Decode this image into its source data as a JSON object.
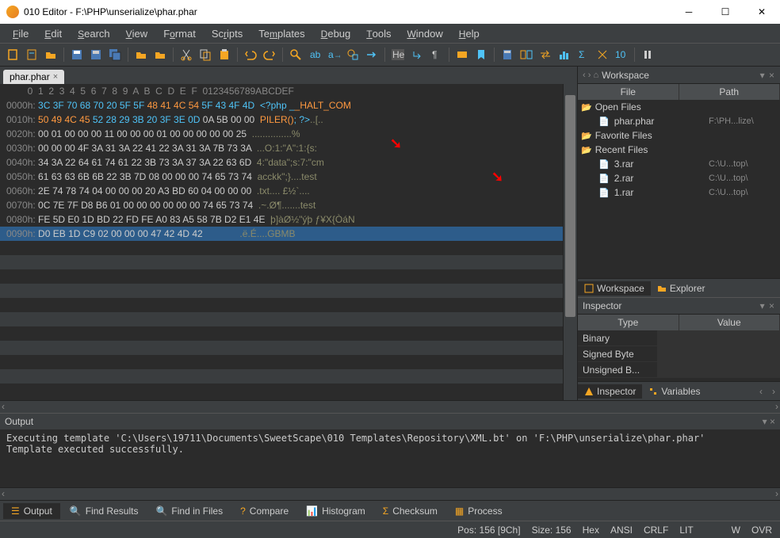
{
  "window": {
    "title": "010 Editor - F:\\PHP\\unserialize\\phar.phar"
  },
  "menu": [
    "File",
    "Edit",
    "Search",
    "View",
    "Format",
    "Scripts",
    "Templates",
    "Debug",
    "Tools",
    "Window",
    "Help"
  ],
  "filetab": {
    "name": "phar.phar"
  },
  "hex": {
    "header_offsets": " 0  1  2  3  4  5  6  7  8  9  A  B  C  D  E  F",
    "header_ascii": "0123456789ABCDEF",
    "rows": [
      {
        "off": "0000h:",
        "b": [
          "3C",
          "3F",
          "70",
          "68",
          "70",
          "20",
          "5F",
          "5F",
          "48",
          "41",
          "4C",
          "54",
          "5F",
          "43",
          "4F",
          "4D"
        ],
        "cls": [
          "hxhl",
          "hxhl",
          "hxhl",
          "hxhl",
          "hxhl",
          "hxhl",
          "hxhl",
          "hxhl",
          "hxor",
          "hxor",
          "hxor",
          "hxor",
          "hxhl",
          "hxhl",
          "hxhl",
          "hxhl"
        ],
        "asc": "<?php __HALT_COM",
        "acls": [
          "ascblue",
          "ascblue",
          "ascblue",
          "ascblue",
          "ascblue",
          "ascblue",
          "ascblue",
          "ascor",
          "ascor",
          "ascor",
          "ascor",
          "ascor",
          "ascor",
          "ascor",
          "ascor",
          "ascor"
        ]
      },
      {
        "off": "0010h:",
        "b": [
          "50",
          "49",
          "4C",
          "45",
          "52",
          "28",
          "29",
          "3B",
          "20",
          "3F",
          "3E",
          "0D",
          "0A",
          "5B",
          "00",
          "00"
        ],
        "cls": [
          "hxor",
          "hxor",
          "hxor",
          "hxor",
          "hxhl",
          "hxhl",
          "hxhl",
          "hxhl",
          "hxhl",
          "hxhl",
          "hxhl",
          "hxhl",
          "hx",
          "hx",
          "hx",
          "hx"
        ],
        "asc": "PILER(); ?>..[..",
        "acls": [
          "ascor",
          "ascor",
          "ascor",
          "ascor",
          "ascor",
          "ascor",
          "ascor",
          "ascblue",
          "ascblue",
          "ascblue",
          "ascblue",
          "ascgr",
          "ascgr",
          "ascgr",
          "ascgr",
          "ascgr"
        ]
      },
      {
        "off": "0020h:",
        "b": [
          "00",
          "01",
          "00",
          "00",
          "00",
          "11",
          "00",
          "00",
          "00",
          "01",
          "00",
          "00",
          "00",
          "00",
          "00",
          "25"
        ],
        "cls": [
          "hx",
          "hx",
          "hx",
          "hx",
          "hx",
          "hx",
          "hx",
          "hx",
          "hx",
          "hx",
          "hx",
          "hx",
          "hx",
          "hx",
          "hx",
          "hx"
        ],
        "asc": "...............%",
        "acls": [
          "ascgr",
          "ascgr",
          "ascgr",
          "ascgr",
          "ascgr",
          "ascgr",
          "ascgr",
          "ascgr",
          "ascgr",
          "ascgr",
          "ascgr",
          "ascgr",
          "ascgr",
          "ascgr",
          "ascgr",
          "ascgr"
        ]
      },
      {
        "off": "0030h:",
        "b": [
          "00",
          "00",
          "00",
          "4F",
          "3A",
          "31",
          "3A",
          "22",
          "41",
          "22",
          "3A",
          "31",
          "3A",
          "7B",
          "73",
          "3A"
        ],
        "cls": [
          "hx",
          "hx",
          "hx",
          "hx",
          "hx",
          "hx",
          "hx",
          "hx",
          "hx",
          "hx",
          "hx",
          "hx",
          "hx",
          "hx",
          "hx",
          "hx"
        ],
        "asc": "...O:1:\"A\":1:{s:",
        "acls": [
          "ascgr",
          "ascgr",
          "ascgr",
          "ascgr",
          "ascgr",
          "ascgr",
          "ascgr",
          "ascgr",
          "ascgr",
          "ascgr",
          "ascgr",
          "ascgr",
          "ascgr",
          "ascgr",
          "ascgr",
          "ascgr"
        ]
      },
      {
        "off": "0040h:",
        "b": [
          "34",
          "3A",
          "22",
          "64",
          "61",
          "74",
          "61",
          "22",
          "3B",
          "73",
          "3A",
          "37",
          "3A",
          "22",
          "63",
          "6D"
        ],
        "cls": [
          "hx",
          "hx",
          "hx",
          "hx",
          "hx",
          "hx",
          "hx",
          "hx",
          "hx",
          "hx",
          "hx",
          "hx",
          "hx",
          "hx",
          "hx",
          "hx"
        ],
        "asc": "4:\"data\";s:7:\"cm",
        "acls": [
          "ascgr",
          "ascgr",
          "ascgr",
          "ascgr",
          "ascgr",
          "ascgr",
          "ascgr",
          "ascgr",
          "ascgr",
          "ascgr",
          "ascgr",
          "ascgr",
          "ascgr",
          "ascgr",
          "ascgr",
          "ascgr"
        ]
      },
      {
        "off": "0050h:",
        "b": [
          "61",
          "63",
          "63",
          "6B",
          "6B",
          "22",
          "3B",
          "7D",
          "08",
          "00",
          "00",
          "00",
          "74",
          "65",
          "73",
          "74"
        ],
        "cls": [
          "hx",
          "hx",
          "hx",
          "hx",
          "hx",
          "hx",
          "hx",
          "hx",
          "hx",
          "hx",
          "hx",
          "hx",
          "hx",
          "hx",
          "hx",
          "hx"
        ],
        "asc": "acckk\";}....test",
        "acls": [
          "ascgr",
          "ascgr",
          "ascgr",
          "ascgr",
          "ascgr",
          "ascgr",
          "ascgr",
          "ascgr",
          "ascgr",
          "ascgr",
          "ascgr",
          "ascgr",
          "ascgr",
          "ascgr",
          "ascgr",
          "ascgr"
        ]
      },
      {
        "off": "0060h:",
        "b": [
          "2E",
          "74",
          "78",
          "74",
          "04",
          "00",
          "00",
          "00",
          "20",
          "A3",
          "BD",
          "60",
          "04",
          "00",
          "00",
          "00"
        ],
        "cls": [
          "hx",
          "hx",
          "hx",
          "hx",
          "hx",
          "hx",
          "hx",
          "hx",
          "hx",
          "hx",
          "hx",
          "hx",
          "hx",
          "hx",
          "hx",
          "hx"
        ],
        "asc": ".txt.... £½`....",
        "acls": [
          "ascgr",
          "ascgr",
          "ascgr",
          "ascgr",
          "ascgr",
          "ascgr",
          "ascgr",
          "ascgr",
          "ascgr",
          "ascgr",
          "ascgr",
          "ascgr",
          "ascgr",
          "ascgr",
          "ascgr",
          "ascgr"
        ]
      },
      {
        "off": "0070h:",
        "b": [
          "0C",
          "7E",
          "7F",
          "D8",
          "B6",
          "01",
          "00",
          "00",
          "00",
          "00",
          "00",
          "00",
          "74",
          "65",
          "73",
          "74"
        ],
        "cls": [
          "hx",
          "hx",
          "hx",
          "hx",
          "hx",
          "hx",
          "hx",
          "hx",
          "hx",
          "hx",
          "hx",
          "hx",
          "hx",
          "hx",
          "hx",
          "hx"
        ],
        "asc": ".~.Ø¶.......test",
        "acls": [
          "ascgr",
          "ascgr",
          "ascgr",
          "ascgr",
          "ascgr",
          "ascgr",
          "ascgr",
          "ascgr",
          "ascgr",
          "ascgr",
          "ascgr",
          "ascgr",
          "ascgr",
          "ascgr",
          "ascgr",
          "ascgr"
        ]
      },
      {
        "off": "0080h:",
        "b": [
          "FE",
          "5D",
          "E0",
          "1D",
          "BD",
          "22",
          "FD",
          "FE",
          "A0",
          "83",
          "A5",
          "58",
          "7B",
          "D2",
          "E1",
          "4E"
        ],
        "cls": [
          "hx",
          "hx",
          "hx",
          "hx",
          "hx",
          "hx",
          "hx",
          "hx",
          "hx",
          "hx",
          "hx",
          "hx",
          "hx",
          "hx",
          "hx",
          "hx"
        ],
        "asc": "þ]àØ½\"ýþ ƒ¥X{ÒáN",
        "acls": [
          "ascgr",
          "ascgr",
          "ascgr",
          "ascgr",
          "ascgr",
          "ascgr",
          "ascgr",
          "ascgr",
          "ascgr",
          "ascgr",
          "ascgr",
          "ascgr",
          "ascgr",
          "ascgr",
          "ascgr",
          "ascgr"
        ]
      },
      {
        "off": "0090h:",
        "b": [
          "D0",
          "EB",
          "1D",
          "C9",
          "02",
          "00",
          "00",
          "00",
          "47",
          "42",
          "4D",
          "42",
          "",
          "",
          "",
          ""
        ],
        "cls": [
          "hx",
          "hx",
          "hx",
          "hx",
          "hx",
          "hx",
          "hx",
          "hx",
          "hx",
          "hx",
          "hx",
          "hx",
          "",
          "",
          "",
          ""
        ],
        "asc": ".ë.É....GBMB",
        "acls": [
          "ascgr",
          "ascgr",
          "ascgr",
          "ascgr",
          "ascgr",
          "ascgr",
          "ascgr",
          "ascgr",
          "ascgr",
          "ascgr",
          "ascgr",
          "ascgr"
        ],
        "sel": true
      }
    ]
  },
  "workspace": {
    "title": "Workspace",
    "cols": [
      "File",
      "Path"
    ],
    "groups": [
      {
        "label": "Open Files",
        "items": [
          {
            "name": "phar.phar",
            "path": "F:\\PH...lize\\"
          }
        ]
      },
      {
        "label": "Favorite Files",
        "items": []
      },
      {
        "label": "Recent Files",
        "items": [
          {
            "name": "3.rar",
            "path": "C:\\U...top\\"
          },
          {
            "name": "2.rar",
            "path": "C:\\U...top\\"
          },
          {
            "name": "1.rar",
            "path": "C:\\U...top\\"
          }
        ]
      }
    ],
    "tabs": [
      "Workspace",
      "Explorer"
    ]
  },
  "inspector": {
    "title": "Inspector",
    "cols": [
      "Type",
      "Value"
    ],
    "rows": [
      "Binary",
      "Signed Byte",
      "Unsigned B..."
    ],
    "tabs": [
      "Inspector",
      "Variables"
    ]
  },
  "output": {
    "title": "Output",
    "text": "Executing template 'C:\\Users\\19711\\Documents\\SweetScape\\010 Templates\\Repository\\XML.bt' on 'F:\\PHP\\unserialize\\phar.phar'\nTemplate executed successfully."
  },
  "bottomtabs": [
    {
      "label": "Output",
      "active": true
    },
    {
      "label": "Find Results"
    },
    {
      "label": "Find in Files"
    },
    {
      "label": "Compare"
    },
    {
      "label": "Histogram"
    },
    {
      "label": "Checksum"
    },
    {
      "label": "Process"
    }
  ],
  "status": {
    "pos": "Pos: 156 [9Ch]",
    "size": "Size: 156",
    "items": [
      "Hex",
      "ANSI",
      "CRLF",
      "LIT",
      "",
      "W",
      "OVR"
    ]
  }
}
